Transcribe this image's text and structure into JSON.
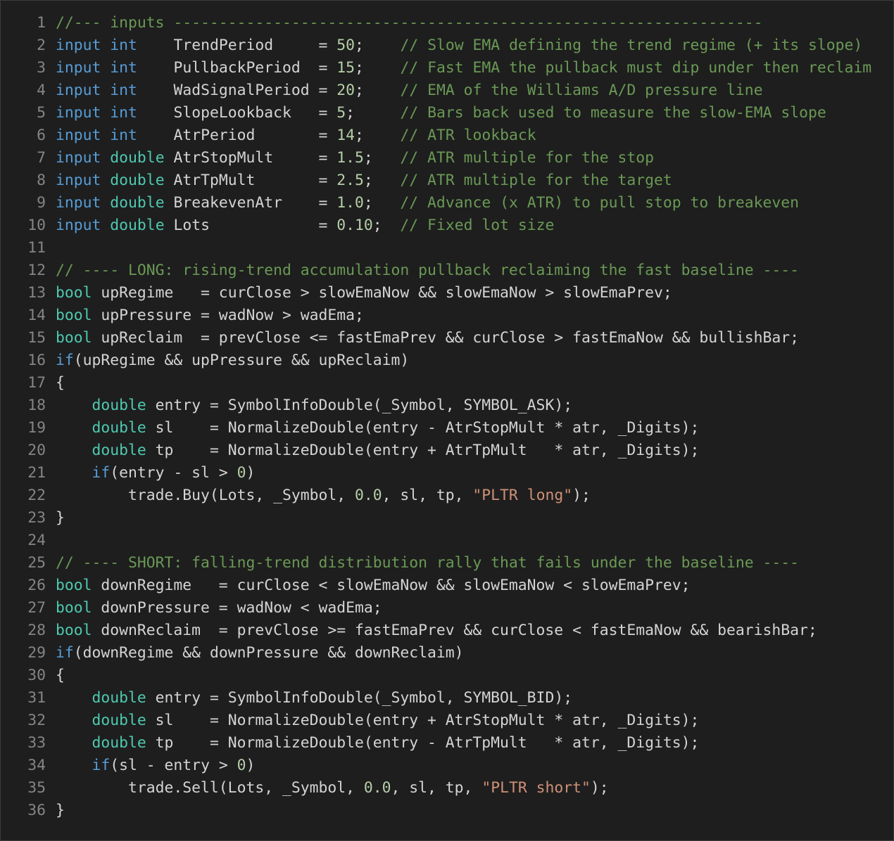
{
  "colors": {
    "background": "#1e1e1e",
    "line_number": "#858585",
    "keyword": "#569cd6",
    "type": "#4ec9b0",
    "comment": "#6a9955",
    "number": "#b5cea8",
    "string": "#ce9178",
    "text": "#d4d4d4"
  },
  "lines": [
    {
      "n": "1",
      "tokens": [
        {
          "t": "cm",
          "v": "//--- inputs -----------------------------------------------------------------"
        }
      ]
    },
    {
      "n": "2",
      "tokens": [
        {
          "t": "kw",
          "v": "input"
        },
        {
          "t": "tx",
          "v": " "
        },
        {
          "t": "kw",
          "v": "int"
        },
        {
          "t": "tx",
          "v": "    TrendPeriod     = "
        },
        {
          "t": "nm",
          "v": "50"
        },
        {
          "t": "tx",
          "v": ";    "
        },
        {
          "t": "cm",
          "v": "// Slow EMA defining the trend regime (+ its slope)"
        }
      ]
    },
    {
      "n": "3",
      "tokens": [
        {
          "t": "kw",
          "v": "input"
        },
        {
          "t": "tx",
          "v": " "
        },
        {
          "t": "kw",
          "v": "int"
        },
        {
          "t": "tx",
          "v": "    PullbackPeriod  = "
        },
        {
          "t": "nm",
          "v": "15"
        },
        {
          "t": "tx",
          "v": ";    "
        },
        {
          "t": "cm",
          "v": "// Fast EMA the pullback must dip under then reclaim"
        }
      ]
    },
    {
      "n": "4",
      "tokens": [
        {
          "t": "kw",
          "v": "input"
        },
        {
          "t": "tx",
          "v": " "
        },
        {
          "t": "kw",
          "v": "int"
        },
        {
          "t": "tx",
          "v": "    WadSignalPeriod = "
        },
        {
          "t": "nm",
          "v": "20"
        },
        {
          "t": "tx",
          "v": ";    "
        },
        {
          "t": "cm",
          "v": "// EMA of the Williams A/D pressure line"
        }
      ]
    },
    {
      "n": "5",
      "tokens": [
        {
          "t": "kw",
          "v": "input"
        },
        {
          "t": "tx",
          "v": " "
        },
        {
          "t": "kw",
          "v": "int"
        },
        {
          "t": "tx",
          "v": "    SlopeLookback   = "
        },
        {
          "t": "nm",
          "v": "5"
        },
        {
          "t": "tx",
          "v": ";     "
        },
        {
          "t": "cm",
          "v": "// Bars back used to measure the slow-EMA slope"
        }
      ]
    },
    {
      "n": "6",
      "tokens": [
        {
          "t": "kw",
          "v": "input"
        },
        {
          "t": "tx",
          "v": " "
        },
        {
          "t": "kw",
          "v": "int"
        },
        {
          "t": "tx",
          "v": "    AtrPeriod       = "
        },
        {
          "t": "nm",
          "v": "14"
        },
        {
          "t": "tx",
          "v": ";    "
        },
        {
          "t": "cm",
          "v": "// ATR lookback"
        }
      ]
    },
    {
      "n": "7",
      "tokens": [
        {
          "t": "kw",
          "v": "input"
        },
        {
          "t": "tx",
          "v": " "
        },
        {
          "t": "ty",
          "v": "double"
        },
        {
          "t": "tx",
          "v": " AtrStopMult     = "
        },
        {
          "t": "nm",
          "v": "1.5"
        },
        {
          "t": "tx",
          "v": ";   "
        },
        {
          "t": "cm",
          "v": "// ATR multiple for the stop"
        }
      ]
    },
    {
      "n": "8",
      "tokens": [
        {
          "t": "kw",
          "v": "input"
        },
        {
          "t": "tx",
          "v": " "
        },
        {
          "t": "ty",
          "v": "double"
        },
        {
          "t": "tx",
          "v": " AtrTpMult       = "
        },
        {
          "t": "nm",
          "v": "2.5"
        },
        {
          "t": "tx",
          "v": ";   "
        },
        {
          "t": "cm",
          "v": "// ATR multiple for the target"
        }
      ]
    },
    {
      "n": "9",
      "tokens": [
        {
          "t": "kw",
          "v": "input"
        },
        {
          "t": "tx",
          "v": " "
        },
        {
          "t": "ty",
          "v": "double"
        },
        {
          "t": "tx",
          "v": " BreakevenAtr    = "
        },
        {
          "t": "nm",
          "v": "1.0"
        },
        {
          "t": "tx",
          "v": ";   "
        },
        {
          "t": "cm",
          "v": "// Advance (x ATR) to pull stop to breakeven"
        }
      ]
    },
    {
      "n": "10",
      "tokens": [
        {
          "t": "kw",
          "v": "input"
        },
        {
          "t": "tx",
          "v": " "
        },
        {
          "t": "ty",
          "v": "double"
        },
        {
          "t": "tx",
          "v": " Lots            = "
        },
        {
          "t": "nm",
          "v": "0.10"
        },
        {
          "t": "tx",
          "v": ";  "
        },
        {
          "t": "cm",
          "v": "// Fixed lot size"
        }
      ]
    },
    {
      "n": "11",
      "tokens": []
    },
    {
      "n": "12",
      "tokens": [
        {
          "t": "cm",
          "v": "// ---- LONG: rising-trend accumulation pullback reclaiming the fast baseline ----"
        }
      ]
    },
    {
      "n": "13",
      "tokens": [
        {
          "t": "ty",
          "v": "bool"
        },
        {
          "t": "tx",
          "v": " upRegime   = curClose > slowEmaNow && slowEmaNow > slowEmaPrev;"
        }
      ]
    },
    {
      "n": "14",
      "tokens": [
        {
          "t": "ty",
          "v": "bool"
        },
        {
          "t": "tx",
          "v": " upPressure = wadNow > wadEma;"
        }
      ]
    },
    {
      "n": "15",
      "tokens": [
        {
          "t": "ty",
          "v": "bool"
        },
        {
          "t": "tx",
          "v": " upReclaim  = prevClose <= fastEmaPrev && curClose > fastEmaNow && bullishBar;"
        }
      ]
    },
    {
      "n": "16",
      "tokens": [
        {
          "t": "kw",
          "v": "if"
        },
        {
          "t": "tx",
          "v": "(upRegime && upPressure && upReclaim)"
        }
      ]
    },
    {
      "n": "17",
      "tokens": [
        {
          "t": "tx",
          "v": "{"
        }
      ]
    },
    {
      "n": "18",
      "tokens": [
        {
          "t": "tx",
          "v": "    "
        },
        {
          "t": "ty",
          "v": "double"
        },
        {
          "t": "tx",
          "v": " entry = SymbolInfoDouble(_Symbol, SYMBOL_ASK);"
        }
      ]
    },
    {
      "n": "19",
      "tokens": [
        {
          "t": "tx",
          "v": "    "
        },
        {
          "t": "ty",
          "v": "double"
        },
        {
          "t": "tx",
          "v": " sl    = NormalizeDouble(entry - AtrStopMult * atr, _Digits);"
        }
      ]
    },
    {
      "n": "20",
      "tokens": [
        {
          "t": "tx",
          "v": "    "
        },
        {
          "t": "ty",
          "v": "double"
        },
        {
          "t": "tx",
          "v": " tp    = NormalizeDouble(entry + AtrTpMult   * atr, _Digits);"
        }
      ]
    },
    {
      "n": "21",
      "tokens": [
        {
          "t": "tx",
          "v": "    "
        },
        {
          "t": "kw",
          "v": "if"
        },
        {
          "t": "tx",
          "v": "(entry - sl > "
        },
        {
          "t": "nm",
          "v": "0"
        },
        {
          "t": "tx",
          "v": ")"
        }
      ]
    },
    {
      "n": "22",
      "tokens": [
        {
          "t": "tx",
          "v": "        trade.Buy(Lots, _Symbol, "
        },
        {
          "t": "nm",
          "v": "0.0"
        },
        {
          "t": "tx",
          "v": ", sl, tp, "
        },
        {
          "t": "st",
          "v": "\"PLTR long\""
        },
        {
          "t": "tx",
          "v": ");"
        }
      ]
    },
    {
      "n": "23",
      "tokens": [
        {
          "t": "tx",
          "v": "}"
        }
      ]
    },
    {
      "n": "24",
      "tokens": []
    },
    {
      "n": "25",
      "tokens": [
        {
          "t": "cm",
          "v": "// ---- SHORT: falling-trend distribution rally that fails under the baseline ----"
        }
      ]
    },
    {
      "n": "26",
      "tokens": [
        {
          "t": "ty",
          "v": "bool"
        },
        {
          "t": "tx",
          "v": " downRegime   = curClose < slowEmaNow && slowEmaNow < slowEmaPrev;"
        }
      ]
    },
    {
      "n": "27",
      "tokens": [
        {
          "t": "ty",
          "v": "bool"
        },
        {
          "t": "tx",
          "v": " downPressure = wadNow < wadEma;"
        }
      ]
    },
    {
      "n": "28",
      "tokens": [
        {
          "t": "ty",
          "v": "bool"
        },
        {
          "t": "tx",
          "v": " downReclaim  = prevClose >= fastEmaPrev && curClose < fastEmaNow && bearishBar;"
        }
      ]
    },
    {
      "n": "29",
      "tokens": [
        {
          "t": "kw",
          "v": "if"
        },
        {
          "t": "tx",
          "v": "(downRegime && downPressure && downReclaim)"
        }
      ]
    },
    {
      "n": "30",
      "tokens": [
        {
          "t": "tx",
          "v": "{"
        }
      ]
    },
    {
      "n": "31",
      "tokens": [
        {
          "t": "tx",
          "v": "    "
        },
        {
          "t": "ty",
          "v": "double"
        },
        {
          "t": "tx",
          "v": " entry = SymbolInfoDouble(_Symbol, SYMBOL_BID);"
        }
      ]
    },
    {
      "n": "32",
      "tokens": [
        {
          "t": "tx",
          "v": "    "
        },
        {
          "t": "ty",
          "v": "double"
        },
        {
          "t": "tx",
          "v": " sl    = NormalizeDouble(entry + AtrStopMult * atr, _Digits);"
        }
      ]
    },
    {
      "n": "33",
      "tokens": [
        {
          "t": "tx",
          "v": "    "
        },
        {
          "t": "ty",
          "v": "double"
        },
        {
          "t": "tx",
          "v": " tp    = NormalizeDouble(entry - AtrTpMult   * atr, _Digits);"
        }
      ]
    },
    {
      "n": "34",
      "tokens": [
        {
          "t": "tx",
          "v": "    "
        },
        {
          "t": "kw",
          "v": "if"
        },
        {
          "t": "tx",
          "v": "(sl - entry > "
        },
        {
          "t": "nm",
          "v": "0"
        },
        {
          "t": "tx",
          "v": ")"
        }
      ]
    },
    {
      "n": "35",
      "tokens": [
        {
          "t": "tx",
          "v": "        trade.Sell(Lots, _Symbol, "
        },
        {
          "t": "nm",
          "v": "0.0"
        },
        {
          "t": "tx",
          "v": ", sl, tp, "
        },
        {
          "t": "st",
          "v": "\"PLTR short\""
        },
        {
          "t": "tx",
          "v": ");"
        }
      ]
    },
    {
      "n": "36",
      "tokens": [
        {
          "t": "tx",
          "v": "}"
        }
      ]
    }
  ]
}
